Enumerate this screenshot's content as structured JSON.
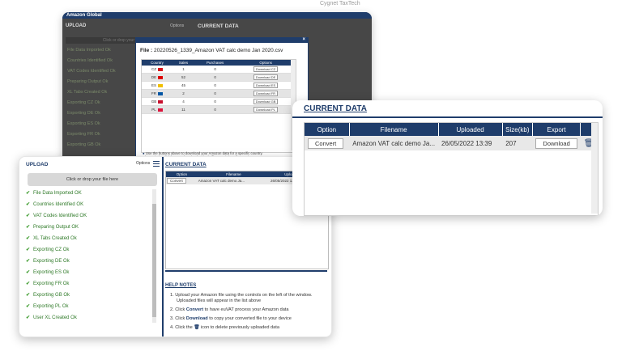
{
  "brand": {
    "company": "Cygnet TaxTech"
  },
  "back_window": {
    "title": "Amazon Global",
    "upload_label": "UPLOAD",
    "options_label": "Options",
    "current_data_label": "CURRENT DATA",
    "drop_label": "Click or drop your file here",
    "statuses": [
      "File Data Imported Ok",
      "Countries Identified Ok",
      "VAT Codes Identified Ok",
      "Preparing Output Ok",
      "XL Tabs Created Ok",
      "Exporting CZ Ok",
      "Exporting DE Ok",
      "Exporting ES Ok",
      "Exporting FR Ok",
      "Exporting GB Ok"
    ]
  },
  "modal": {
    "close": "×",
    "file_label": "File :",
    "file_name": "20220526_1339_Amazon VAT calc demo Jan 2020.csv",
    "headers": [
      "Country",
      "Sales",
      "Purchases",
      "Options"
    ],
    "rows": [
      {
        "country": "CZ",
        "sales": "1",
        "purchases": "0",
        "button": "Download CZ",
        "flag": "#d7141a"
      },
      {
        "country": "DE",
        "sales": "52",
        "purchases": "0",
        "button": "Download DE",
        "flag": "#dd0000"
      },
      {
        "country": "ES",
        "sales": "45",
        "purchases": "0",
        "button": "Download ES",
        "flag": "#f1bf00"
      },
      {
        "country": "FR",
        "sales": "2",
        "purchases": "0",
        "button": "Download FR",
        "flag": "#0055a4"
      },
      {
        "country": "GB",
        "sales": "4",
        "purchases": "0",
        "button": "Download GB",
        "flag": "#c8102e"
      },
      {
        "country": "PL",
        "sales": "11",
        "purchases": "0",
        "button": "Download PL",
        "flag": "#dc143c"
      }
    ],
    "help_line1": "Use the buttons above to download your Amazon data for a specific country.",
    "help_line2_pre": "Alternatively, ",
    "help_link": "click here",
    "help_line2_post": " to download a single file containing all countries"
  },
  "main": {
    "upload_label": "UPLOAD",
    "options_label": "Options",
    "drop_label": "Click or drop your file here",
    "statuses": [
      "File Data Imported OK",
      "Countries Identified OK",
      "VAT Codes Identified OK",
      "Preparing Output OK",
      "XL Tabs Created Ok",
      "Exporting CZ Ok",
      "Exporting DE Ok",
      "Exporting ES Ok",
      "Exporting FR Ok",
      "Exporting GB Ok",
      "Exporting PL Ok",
      "User XL Created Ok"
    ],
    "current_data_label": "CURRENT DATA",
    "table": {
      "headers": [
        "Option",
        "Filename",
        "Uploaded",
        "Size"
      ],
      "row": {
        "option": "Convert",
        "filename": "Amazon VAT calc demo Ja...",
        "uploaded": "26/05/2022 13:39",
        "size": "207"
      }
    },
    "help_title": "HELP NOTES",
    "help": [
      {
        "num": "1.",
        "text": "Upload your Amazon file using the controls on the left of the window."
      },
      {
        "num": "",
        "text": "Uploaded files will appear in the list above"
      },
      {
        "num": "2.",
        "pre": "Click ",
        "bold": "Convert",
        "post": " to have euVAT process your Amazon data"
      },
      {
        "num": "3.",
        "pre": "Click ",
        "bold": "Download",
        "post": " to copy your converted file to your device"
      },
      {
        "num": "4.",
        "pre": "Click the ",
        "bold": "🗑",
        "post": " icon to delete previously uploaded data"
      }
    ]
  },
  "zoom": {
    "title": "CURRENT DATA",
    "headers": [
      "Option",
      "Filename",
      "Uploaded",
      "Size(kb)",
      "Export"
    ],
    "row": {
      "option": "Convert",
      "filename": "Amazon VAT calc demo Ja...",
      "uploaded": "26/05/2022 13:39",
      "size": "207",
      "export": "Download"
    }
  }
}
